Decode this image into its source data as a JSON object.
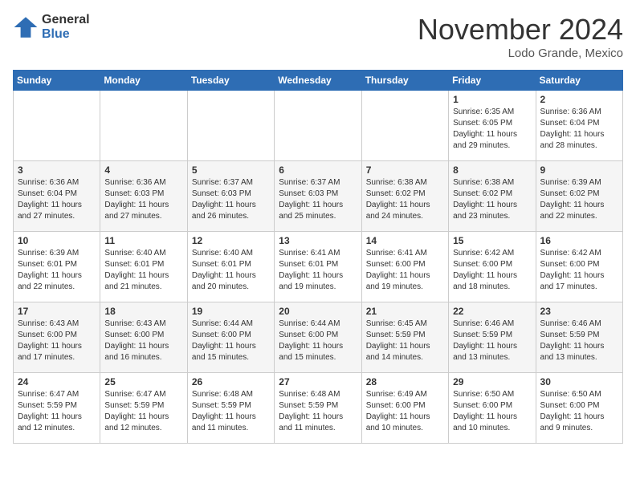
{
  "header": {
    "logo_general": "General",
    "logo_blue": "Blue",
    "month_title": "November 2024",
    "location": "Lodo Grande, Mexico"
  },
  "weekdays": [
    "Sunday",
    "Monday",
    "Tuesday",
    "Wednesday",
    "Thursday",
    "Friday",
    "Saturday"
  ],
  "weeks": [
    [
      {
        "day": "",
        "info": ""
      },
      {
        "day": "",
        "info": ""
      },
      {
        "day": "",
        "info": ""
      },
      {
        "day": "",
        "info": ""
      },
      {
        "day": "",
        "info": ""
      },
      {
        "day": "1",
        "info": "Sunrise: 6:35 AM\nSunset: 6:05 PM\nDaylight: 11 hours\nand 29 minutes."
      },
      {
        "day": "2",
        "info": "Sunrise: 6:36 AM\nSunset: 6:04 PM\nDaylight: 11 hours\nand 28 minutes."
      }
    ],
    [
      {
        "day": "3",
        "info": "Sunrise: 6:36 AM\nSunset: 6:04 PM\nDaylight: 11 hours\nand 27 minutes."
      },
      {
        "day": "4",
        "info": "Sunrise: 6:36 AM\nSunset: 6:03 PM\nDaylight: 11 hours\nand 27 minutes."
      },
      {
        "day": "5",
        "info": "Sunrise: 6:37 AM\nSunset: 6:03 PM\nDaylight: 11 hours\nand 26 minutes."
      },
      {
        "day": "6",
        "info": "Sunrise: 6:37 AM\nSunset: 6:03 PM\nDaylight: 11 hours\nand 25 minutes."
      },
      {
        "day": "7",
        "info": "Sunrise: 6:38 AM\nSunset: 6:02 PM\nDaylight: 11 hours\nand 24 minutes."
      },
      {
        "day": "8",
        "info": "Sunrise: 6:38 AM\nSunset: 6:02 PM\nDaylight: 11 hours\nand 23 minutes."
      },
      {
        "day": "9",
        "info": "Sunrise: 6:39 AM\nSunset: 6:02 PM\nDaylight: 11 hours\nand 22 minutes."
      }
    ],
    [
      {
        "day": "10",
        "info": "Sunrise: 6:39 AM\nSunset: 6:01 PM\nDaylight: 11 hours\nand 22 minutes."
      },
      {
        "day": "11",
        "info": "Sunrise: 6:40 AM\nSunset: 6:01 PM\nDaylight: 11 hours\nand 21 minutes."
      },
      {
        "day": "12",
        "info": "Sunrise: 6:40 AM\nSunset: 6:01 PM\nDaylight: 11 hours\nand 20 minutes."
      },
      {
        "day": "13",
        "info": "Sunrise: 6:41 AM\nSunset: 6:01 PM\nDaylight: 11 hours\nand 19 minutes."
      },
      {
        "day": "14",
        "info": "Sunrise: 6:41 AM\nSunset: 6:00 PM\nDaylight: 11 hours\nand 19 minutes."
      },
      {
        "day": "15",
        "info": "Sunrise: 6:42 AM\nSunset: 6:00 PM\nDaylight: 11 hours\nand 18 minutes."
      },
      {
        "day": "16",
        "info": "Sunrise: 6:42 AM\nSunset: 6:00 PM\nDaylight: 11 hours\nand 17 minutes."
      }
    ],
    [
      {
        "day": "17",
        "info": "Sunrise: 6:43 AM\nSunset: 6:00 PM\nDaylight: 11 hours\nand 17 minutes."
      },
      {
        "day": "18",
        "info": "Sunrise: 6:43 AM\nSunset: 6:00 PM\nDaylight: 11 hours\nand 16 minutes."
      },
      {
        "day": "19",
        "info": "Sunrise: 6:44 AM\nSunset: 6:00 PM\nDaylight: 11 hours\nand 15 minutes."
      },
      {
        "day": "20",
        "info": "Sunrise: 6:44 AM\nSunset: 6:00 PM\nDaylight: 11 hours\nand 15 minutes."
      },
      {
        "day": "21",
        "info": "Sunrise: 6:45 AM\nSunset: 5:59 PM\nDaylight: 11 hours\nand 14 minutes."
      },
      {
        "day": "22",
        "info": "Sunrise: 6:46 AM\nSunset: 5:59 PM\nDaylight: 11 hours\nand 13 minutes."
      },
      {
        "day": "23",
        "info": "Sunrise: 6:46 AM\nSunset: 5:59 PM\nDaylight: 11 hours\nand 13 minutes."
      }
    ],
    [
      {
        "day": "24",
        "info": "Sunrise: 6:47 AM\nSunset: 5:59 PM\nDaylight: 11 hours\nand 12 minutes."
      },
      {
        "day": "25",
        "info": "Sunrise: 6:47 AM\nSunset: 5:59 PM\nDaylight: 11 hours\nand 12 minutes."
      },
      {
        "day": "26",
        "info": "Sunrise: 6:48 AM\nSunset: 5:59 PM\nDaylight: 11 hours\nand 11 minutes."
      },
      {
        "day": "27",
        "info": "Sunrise: 6:48 AM\nSunset: 5:59 PM\nDaylight: 11 hours\nand 11 minutes."
      },
      {
        "day": "28",
        "info": "Sunrise: 6:49 AM\nSunset: 6:00 PM\nDaylight: 11 hours\nand 10 minutes."
      },
      {
        "day": "29",
        "info": "Sunrise: 6:50 AM\nSunset: 6:00 PM\nDaylight: 11 hours\nand 10 minutes."
      },
      {
        "day": "30",
        "info": "Sunrise: 6:50 AM\nSunset: 6:00 PM\nDaylight: 11 hours\nand 9 minutes."
      }
    ]
  ]
}
